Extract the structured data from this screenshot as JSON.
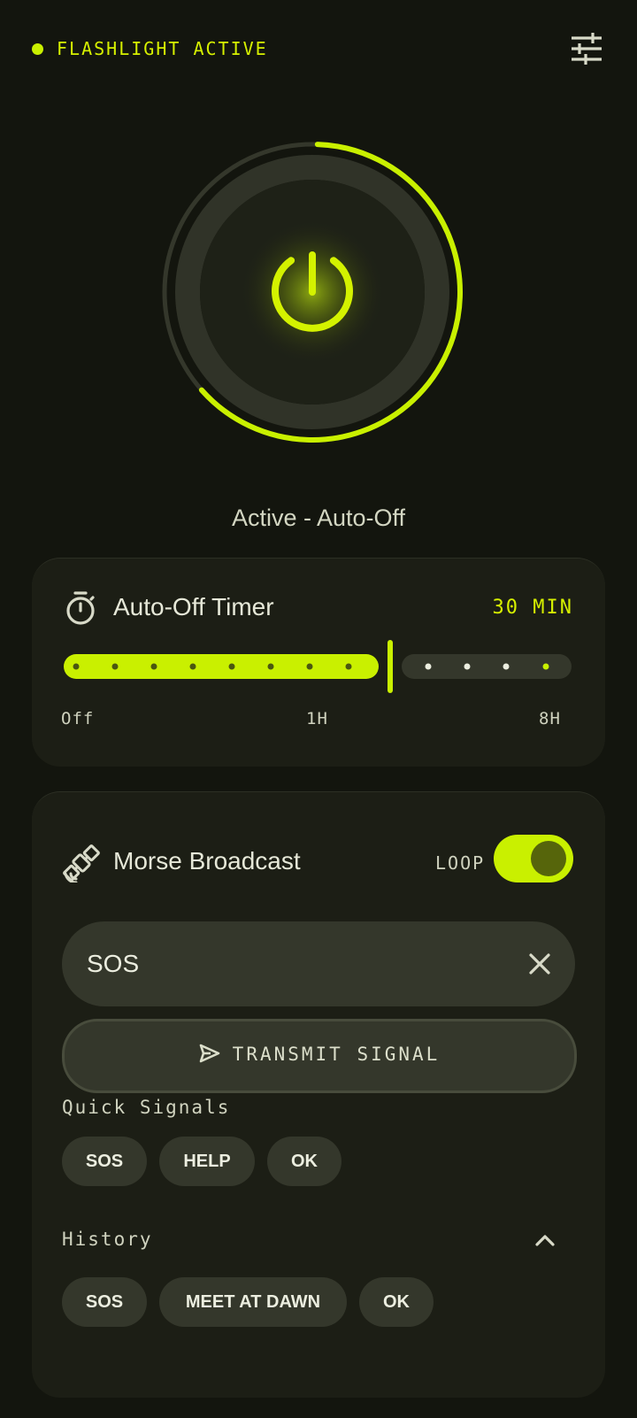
{
  "header": {
    "status": "FLASHLIGHT ACTIVE",
    "settings_icon": "tune-icon"
  },
  "power": {
    "label": "Active - Auto-Off",
    "icon": "power-icon"
  },
  "timer": {
    "title": "Auto-Off Timer",
    "value": "30 MIN",
    "labels": {
      "off": "Off",
      "mid": "1H",
      "max": "8H"
    },
    "icon": "timer-icon"
  },
  "morse": {
    "title": "Morse Broadcast",
    "loop_label": "LOOP",
    "loop_enabled": true,
    "input_value": "SOS",
    "transmit_label": "TRANSMIT SIGNAL",
    "quick_label": "Quick Signals",
    "quick_signals": [
      "SOS",
      "HELP",
      "OK"
    ],
    "history_label": "History",
    "history": [
      "SOS",
      "MEET AT DAWN",
      "OK"
    ],
    "icon": "satellite-icon"
  },
  "colors": {
    "accent": "#c9f000",
    "background": "#13150e",
    "card": "#1c1e15",
    "surface": "#34372b"
  }
}
